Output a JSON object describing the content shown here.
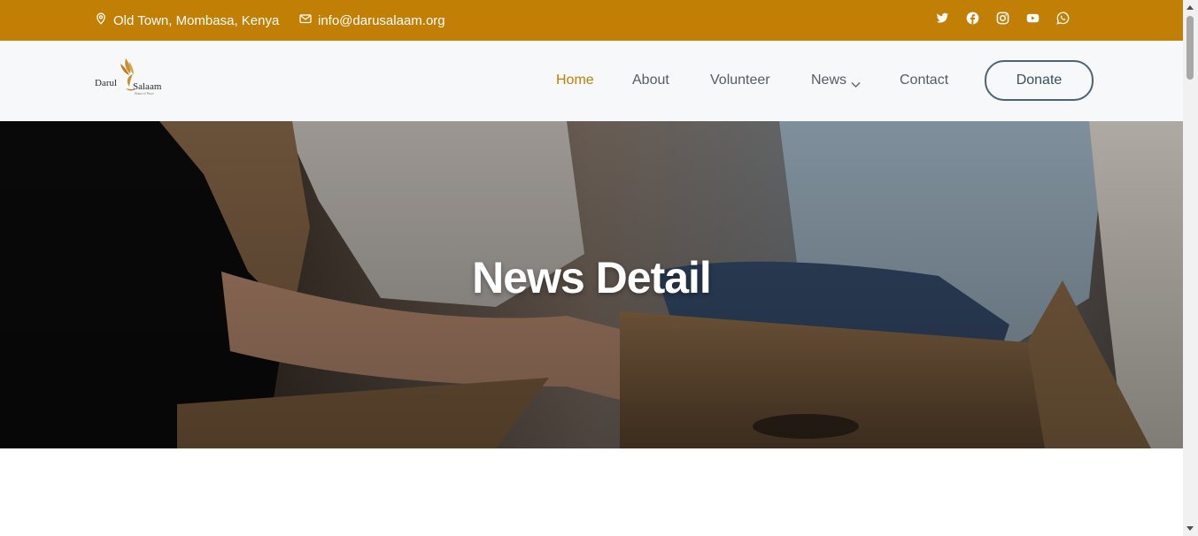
{
  "topbar": {
    "address": "Old Town, Mombasa, Kenya",
    "email": "info@darusalaam.org",
    "social_icons": [
      "twitter-icon",
      "facebook-icon",
      "instagram-icon",
      "youtube-icon",
      "whatsapp-icon"
    ],
    "background": "#c17f05"
  },
  "logo": {
    "word1": "Darul",
    "word2": "Salaam",
    "tagline": "Home of Peace"
  },
  "nav": {
    "items": [
      {
        "label": "Home",
        "active": true
      },
      {
        "label": "About"
      },
      {
        "label": "Volunteer"
      },
      {
        "label": "News",
        "has_dropdown": true
      },
      {
        "label": "Contact"
      }
    ],
    "donate_label": "Donate",
    "active_color": "#c17f05"
  },
  "hero": {
    "title": "News Detail"
  }
}
